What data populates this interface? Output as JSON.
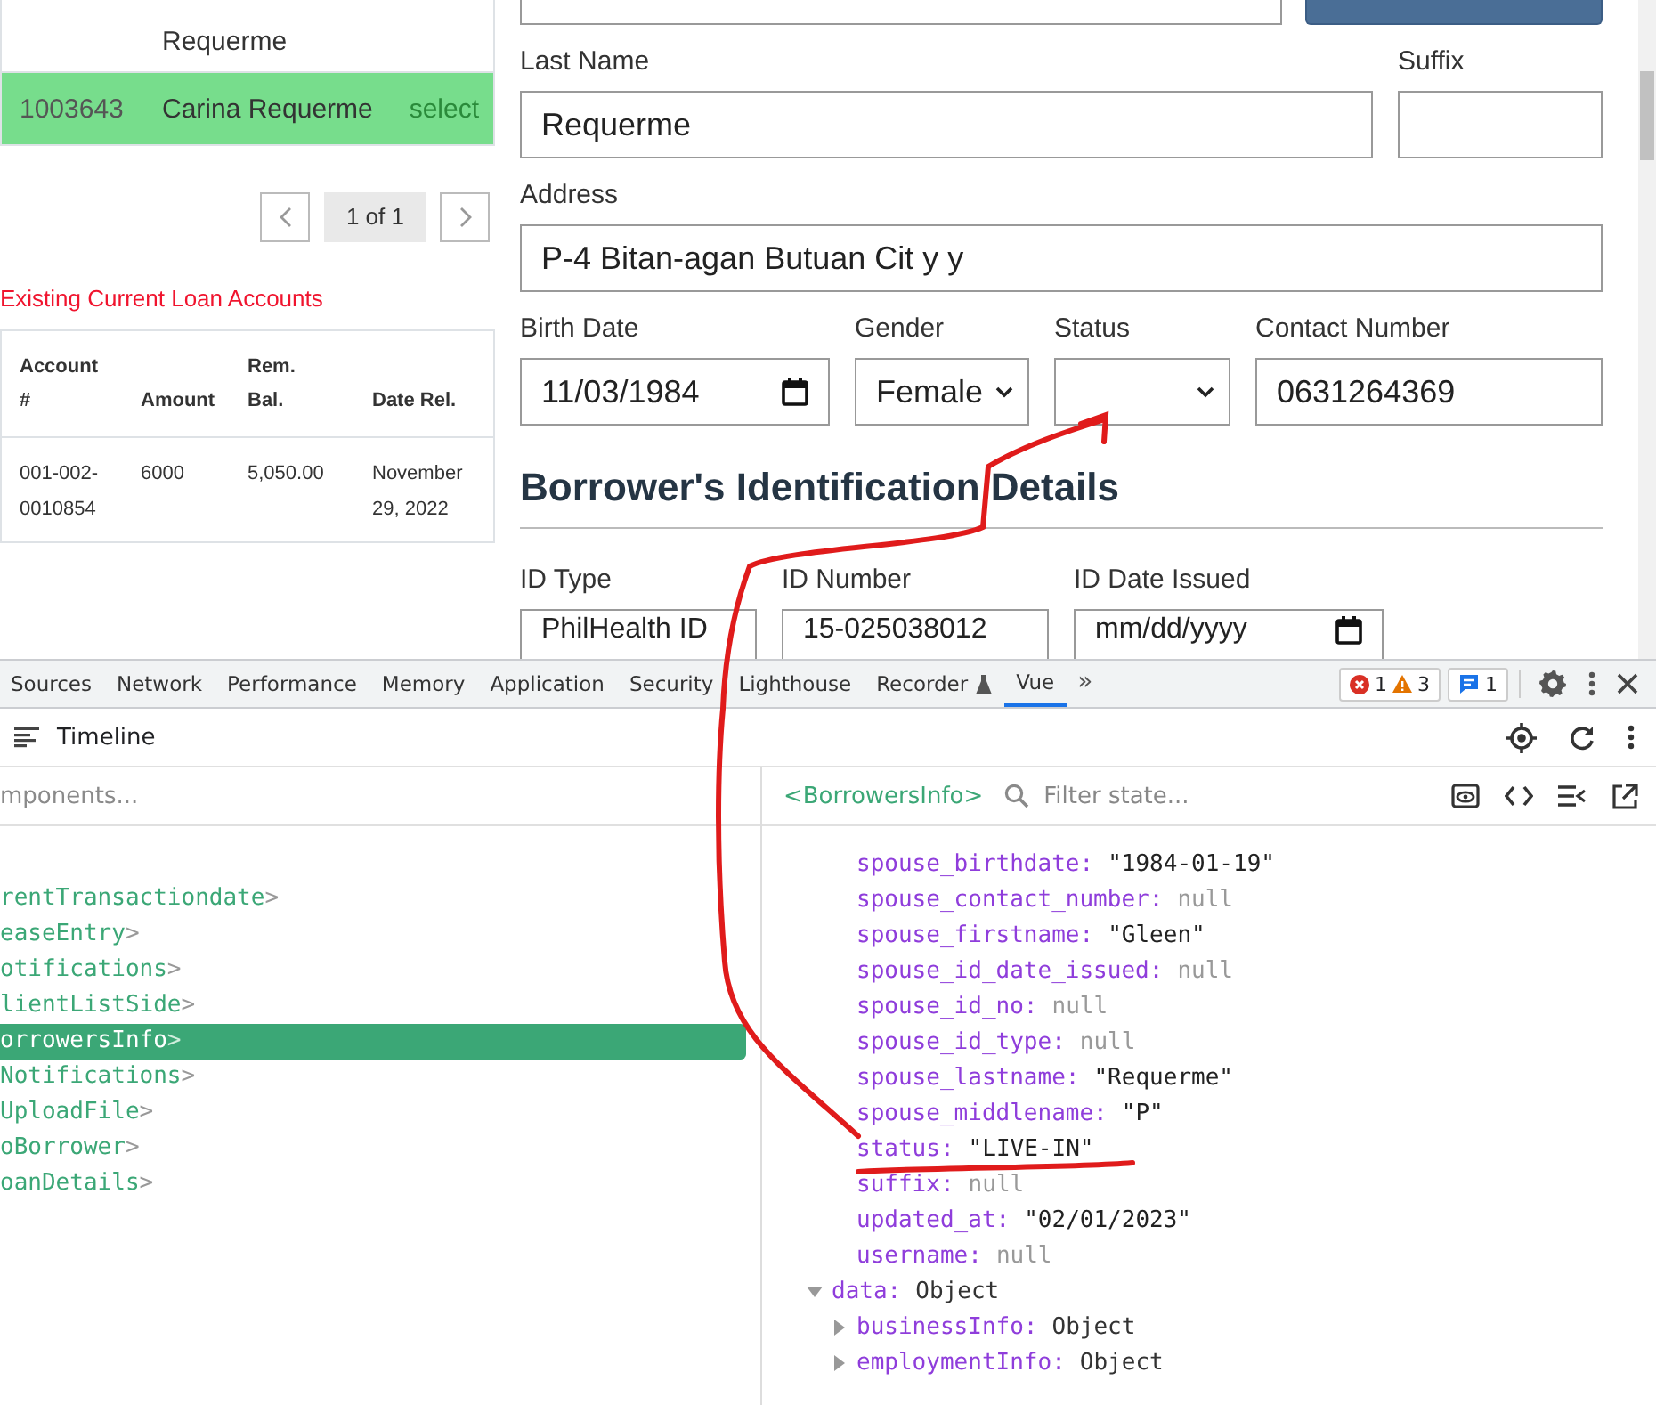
{
  "client_list": {
    "rows": [
      {
        "name": "Requerme",
        "selected": false
      },
      {
        "id": "1003643",
        "name": "Carina Requerme",
        "action": "select",
        "selected": true
      }
    ]
  },
  "pager": {
    "label": "1 of 1"
  },
  "loans": {
    "title": "Existing Current Loan Accounts",
    "columns": [
      "Account #",
      "Amount",
      "Rem. Bal.",
      "Date Rel."
    ],
    "rows": [
      [
        "001-002-0010854",
        "6000",
        "5,050.00",
        "November 29, 2022"
      ]
    ]
  },
  "form": {
    "name_fields": [
      {
        "label": "Last Name",
        "kind": "text",
        "value": "Requerme"
      },
      {
        "label": "Suffix",
        "kind": "text"
      }
    ],
    "address_fields": [
      {
        "label": "Address",
        "kind": "text",
        "value": "P-4 Bitan-agan Butuan Cit y y"
      }
    ],
    "personal_fields": [
      {
        "label": "Birth Date",
        "kind": "date",
        "value": "11/03/1984"
      },
      {
        "label": "Gender",
        "kind": "select",
        "value": "Female"
      },
      {
        "label": "Status",
        "kind": "select"
      },
      {
        "label": "Contact Number",
        "kind": "text",
        "value": "0631264369"
      }
    ],
    "heading": "Borrower's Identification Details",
    "id_fields": [
      {
        "label": "ID Type",
        "kind": "text",
        "value": "PhilHealth ID"
      },
      {
        "label": "ID Number",
        "kind": "text",
        "value": "15-025038012"
      },
      {
        "label": "ID Date Issued",
        "kind": "date",
        "placeholder": "mm/dd/yyyy"
      }
    ]
  },
  "devtools": {
    "tabs": [
      {
        "label": "Sources",
        "selected": false
      },
      {
        "label": "Network",
        "selected": false
      },
      {
        "label": "Performance",
        "selected": false
      },
      {
        "label": "Memory",
        "selected": false
      },
      {
        "label": "Application",
        "selected": false
      },
      {
        "label": "Security",
        "selected": false
      },
      {
        "label": "Lighthouse",
        "selected": false
      },
      {
        "label": "Recorder",
        "selected": false,
        "flask": true
      },
      {
        "label": "Vue",
        "selected": true
      }
    ],
    "more": "»",
    "errors": "1",
    "warnings": "3",
    "messages": "1",
    "toolbar_title": "Timeline",
    "components_filter": {
      "placeholder": "mponents..."
    },
    "components": [
      {
        "label": "rentTransactiondate",
        "bracket": ">",
        "selected": false
      },
      {
        "label": "easeEntry",
        "bracket": ">",
        "selected": false
      },
      {
        "label": "otifications",
        "bracket": ">",
        "selected": false
      },
      {
        "label": "lientListSide",
        "bracket": ">",
        "selected": false
      },
      {
        "label": "orrowersInfo",
        "bracket": ">",
        "selected": true
      },
      {
        "label": "Notifications",
        "bracket": ">",
        "selected": false
      },
      {
        "label": "UploadFile",
        "bracket": ">",
        "selected": false
      },
      {
        "label": "oBorrower",
        "bracket": ">",
        "selected": false
      },
      {
        "label": "oanDetails",
        "bracket": ">",
        "selected": false
      }
    ],
    "inspector": {
      "component": "<BorrowersInfo>",
      "filter_placeholder": "Filter state..."
    },
    "state": [
      {
        "key": "spouse_birthdate:",
        "value": "\"1984-01-19\"",
        "kind": "string"
      },
      {
        "key": "spouse_contact_number:",
        "value": "null",
        "kind": "null"
      },
      {
        "key": "spouse_firstname:",
        "value": "\"Gleen\"",
        "kind": "string"
      },
      {
        "key": "spouse_id_date_issued:",
        "value": "null",
        "kind": "null"
      },
      {
        "key": "spouse_id_no:",
        "value": "null",
        "kind": "null"
      },
      {
        "key": "spouse_id_type:",
        "value": "null",
        "kind": "null"
      },
      {
        "key": "spouse_lastname:",
        "value": "\"Requerme\"",
        "kind": "string"
      },
      {
        "key": "spouse_middlename:",
        "value": "\"P\"",
        "kind": "string"
      },
      {
        "key": "status:",
        "value": "\"LIVE-IN\"",
        "kind": "string"
      },
      {
        "key": "suffix:",
        "value": "null",
        "kind": "null"
      },
      {
        "key": "updated_at:",
        "value": "\"02/01/2023\"",
        "kind": "string"
      },
      {
        "key": "username:",
        "value": "null",
        "kind": "null"
      },
      {
        "key": "data:",
        "value": "Object",
        "kind": "object",
        "expanded": true,
        "children": [
          {
            "key": "businessInfo:",
            "value": "Object",
            "kind": "object",
            "expanded": false
          },
          {
            "key": "employmentInfo:",
            "value": "Object",
            "kind": "object",
            "expanded": false
          }
        ]
      }
    ]
  }
}
